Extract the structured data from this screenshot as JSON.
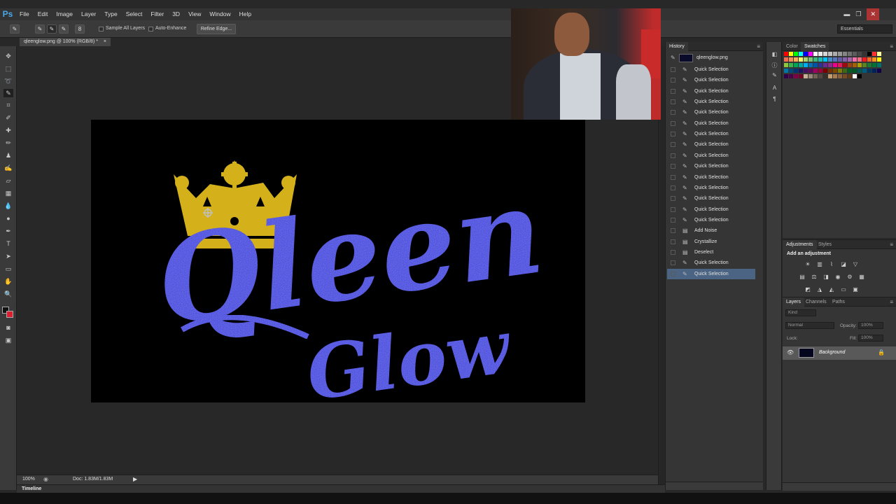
{
  "app": {
    "logo": "Ps"
  },
  "menu": [
    "File",
    "Edit",
    "Image",
    "Layer",
    "Type",
    "Select",
    "Filter",
    "3D",
    "View",
    "Window",
    "Help"
  ],
  "window_controls": {
    "minimize": "▬",
    "restore": "❐",
    "close": "✕"
  },
  "options": {
    "brush_size": "8",
    "sample_all_layers": "Sample All Layers",
    "auto_enhance": "Auto-Enhance",
    "refine_edge": "Refine Edge...",
    "workspace": "Essentials"
  },
  "document": {
    "tab_title": "qleenglow.png @ 100% (RGB/8) *",
    "tab_close": "×"
  },
  "artwork": {
    "word1": "Qleen",
    "word2": "Glow"
  },
  "status": {
    "zoom": "100%",
    "doc_info": "Doc: 1.83M/1.83M",
    "arrow": "▶"
  },
  "timeline": {
    "label": "Timeline"
  },
  "history": {
    "tab": "History",
    "snapshot": "qleenglow.png",
    "items": [
      "Quick Selection",
      "Quick Selection",
      "Quick Selection",
      "Quick Selection",
      "Quick Selection",
      "Quick Selection",
      "Quick Selection",
      "Quick Selection",
      "Quick Selection",
      "Quick Selection",
      "Quick Selection",
      "Quick Selection",
      "Quick Selection",
      "Quick Selection",
      "Quick Selection",
      "Add Noise",
      "Crystallize",
      "Deselect",
      "Quick Selection",
      "Quick Selection"
    ],
    "selected_index": 19
  },
  "color_panel": {
    "tabs": [
      "Color",
      "Swatches"
    ],
    "active": "Swatches"
  },
  "adjustments": {
    "tabs": [
      "Adjustments",
      "Styles"
    ],
    "title": "Add an adjustment"
  },
  "layers": {
    "tabs": [
      "Layers",
      "Channels",
      "Paths"
    ],
    "kind": "Kind",
    "blend": "Normal",
    "opacity_label": "Opacity:",
    "opacity": "100%",
    "lock_label": "Lock:",
    "fill_label": "Fill:",
    "fill": "100%",
    "layer_name": "Background"
  },
  "colors": {
    "accent": "#4b6483",
    "bg_color": "#d8202e",
    "crown": "#d4b11a",
    "text_blue": "#2c32e8"
  }
}
